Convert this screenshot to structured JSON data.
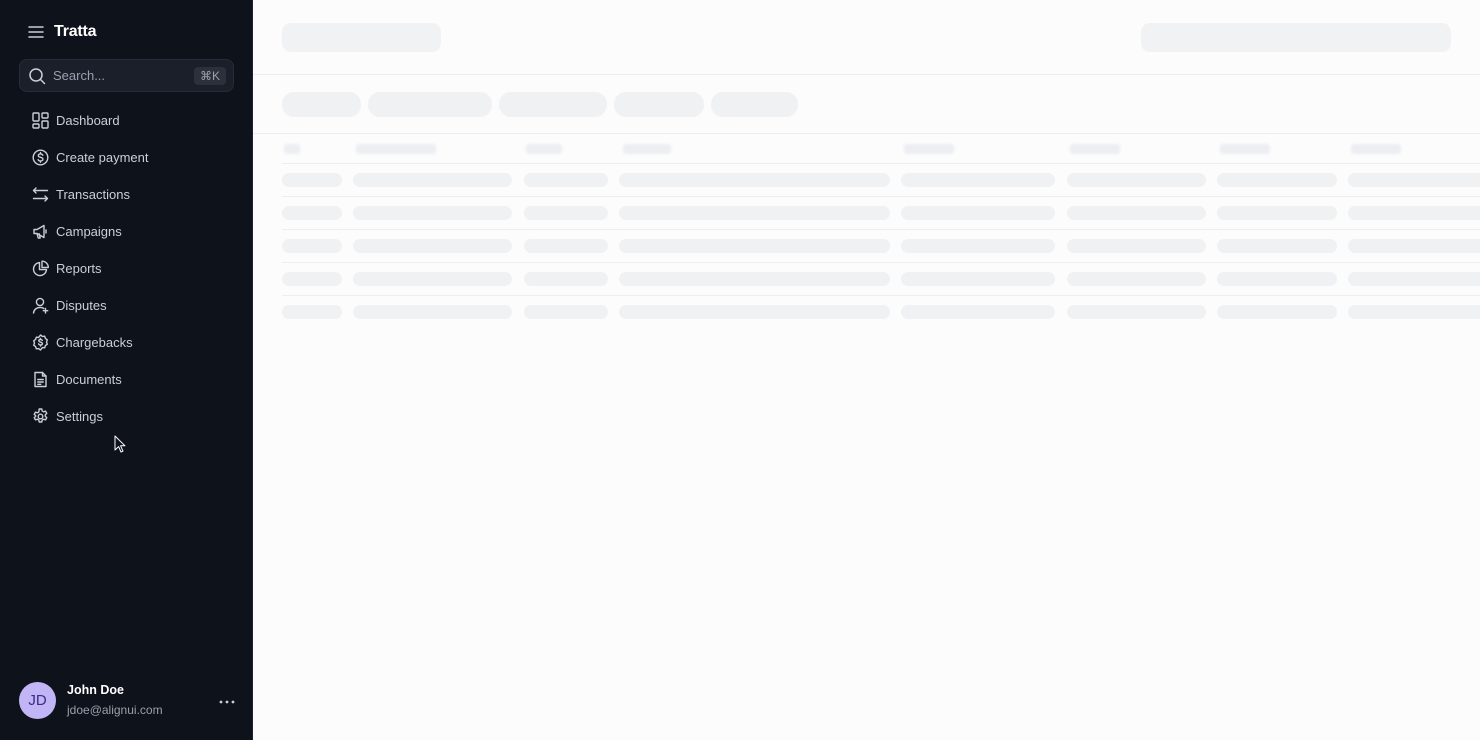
{
  "app": {
    "name": "Tratta"
  },
  "search": {
    "placeholder": "Search...",
    "shortcut": "⌘K"
  },
  "nav": {
    "items": [
      {
        "label": "Dashboard",
        "icon": "layout-grid-icon"
      },
      {
        "label": "Create payment",
        "icon": "dollar-circle-icon"
      },
      {
        "label": "Transactions",
        "icon": "arrows-left-right-icon"
      },
      {
        "label": "Campaigns",
        "icon": "megaphone-icon"
      },
      {
        "label": "Reports",
        "icon": "pie-chart-icon"
      },
      {
        "label": "Disputes",
        "icon": "user-icon"
      },
      {
        "label": "Chargebacks",
        "icon": "dollar-badge-icon"
      },
      {
        "label": "Documents",
        "icon": "file-text-icon"
      },
      {
        "label": "Settings",
        "icon": "gear-icon"
      }
    ]
  },
  "user": {
    "initials": "JD",
    "name": "John Doe",
    "email": "jdoe@alignui.com"
  },
  "colors": {
    "sidebar_bg": "#0e121b",
    "content_bg": "#fcfcfd",
    "skeleton": "#f1f2f4",
    "avatar_bg": "#c2b5f5"
  }
}
